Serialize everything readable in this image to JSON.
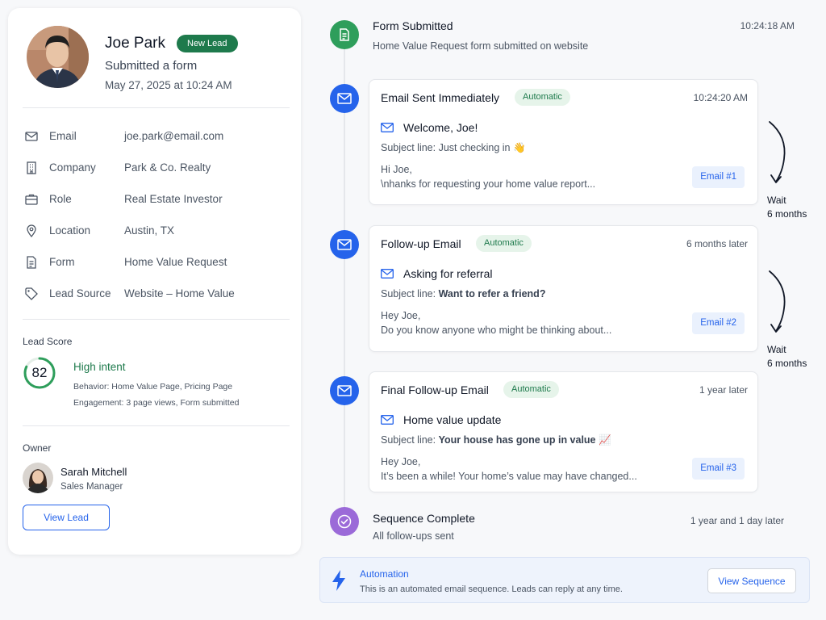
{
  "lead": {
    "name": "Joe Park",
    "badge": "New Lead",
    "action": "Submitted a form",
    "date": "May 27, 2025 at 10:24 AM",
    "details": [
      {
        "icon": "mail-icon",
        "label": "Email",
        "value": "joe.park@email.com"
      },
      {
        "icon": "building-icon",
        "label": "Company",
        "value": "Park & Co. Realty"
      },
      {
        "icon": "briefcase-icon",
        "label": "Role",
        "value": "Real Estate Investor"
      },
      {
        "icon": "location-pin-icon",
        "label": "Location",
        "value": "Austin, TX"
      },
      {
        "icon": "document-icon",
        "label": "Form",
        "value": "Home Value Request"
      },
      {
        "icon": "tag-icon",
        "label": "Lead Source",
        "value": "Website – Home Value"
      }
    ],
    "score_label": "Lead Score",
    "score": "82",
    "score_fraction": 0.82,
    "intent": "High intent",
    "behavior": "Behavior: Home Value Page, Pricing Page",
    "engagement": "Engagement: 3 page views, Form submitted",
    "owner_label": "Owner",
    "owner_name": "Sarah Mitchell",
    "owner_role": "Sales Manager",
    "view_lead_label": "View Lead"
  },
  "timeline": {
    "form_submitted": {
      "title": "Form Submitted",
      "subtitle": "Home Value Request form submitted on website",
      "time": "10:24:18 AM"
    },
    "emails": [
      {
        "title": "Email Sent Immediately",
        "badge": "Automatic",
        "time": "10:24:20 AM",
        "subject_title": "Welcome, Joe!",
        "subject_prefix": "Subject line: ",
        "subject_value": "Just checking in 👋",
        "body_line1": "Hi Joe,",
        "body_line2": "\\nhanks for requesting your home value report...",
        "email_number": "Email #1"
      },
      {
        "title": "Follow-up Email",
        "badge": "Automatic",
        "time": "6 months later",
        "subject_title": "Asking for referral",
        "subject_prefix": "Subject line: ",
        "subject_value": "Want to refer a friend?",
        "body_line1": "Hey Joe,",
        "body_line2": "Do you know anyone who might be thinking about...",
        "email_number": "Email #2"
      },
      {
        "title": "Final Follow-up Email",
        "badge": "Automatic",
        "time": "1 year later",
        "subject_title": "Home value update",
        "subject_prefix": "Subject line: ",
        "subject_value": "Your house has gone up in value 📈",
        "body_line1": "Hey Joe,",
        "body_line2": "It’s been a while! Your home’s value may have changed...",
        "email_number": "Email #3"
      }
    ],
    "waits": [
      {
        "label": "Wait",
        "duration": "6 months"
      },
      {
        "label": "Wait",
        "duration": "6 months"
      }
    ],
    "complete": {
      "title": "Sequence Complete",
      "subtitle": "All follow-ups sent",
      "time": "1 year and 1 day later"
    }
  },
  "automation": {
    "title": "Automation",
    "description": "This is an automated email sequence. Leads can reply at any time.",
    "button_label": "View Sequence"
  },
  "colors": {
    "accent_blue": "#2563eb",
    "brand_green": "#1e7a4c",
    "node_green": "#2e9e5b",
    "node_purple": "#9b6ad8"
  }
}
